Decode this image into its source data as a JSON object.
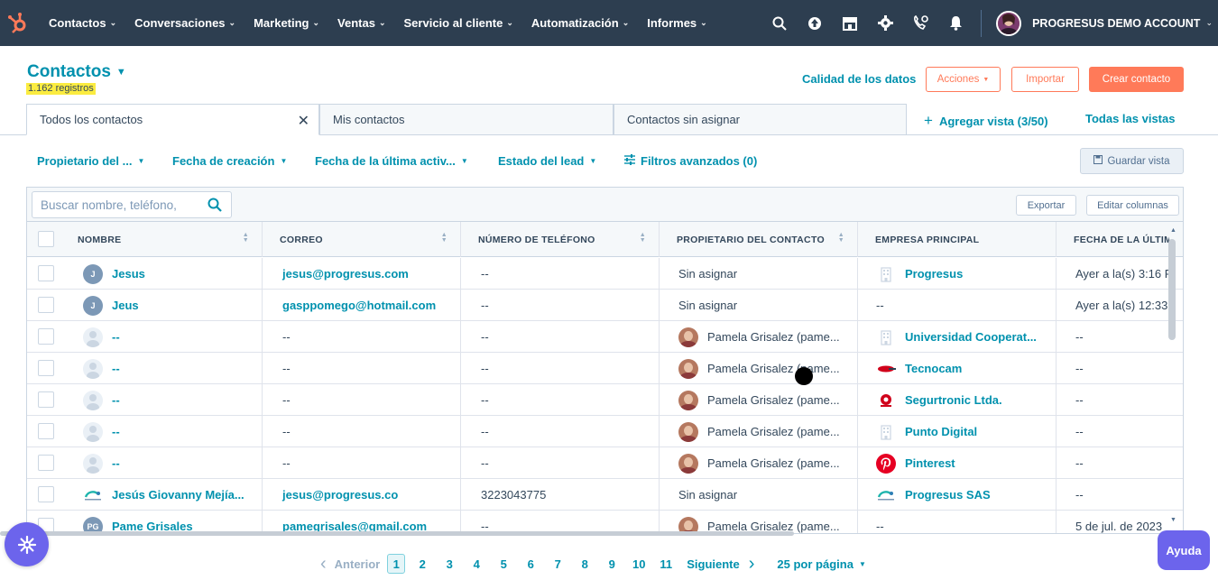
{
  "nav": {
    "items": [
      {
        "label": "Contactos"
      },
      {
        "label": "Conversaciones"
      },
      {
        "label": "Marketing"
      },
      {
        "label": "Ventas"
      },
      {
        "label": "Servicio al cliente"
      },
      {
        "label": "Automatización"
      },
      {
        "label": "Informes"
      }
    ],
    "icons": [
      "search-icon",
      "upgrade-icon",
      "marketplace-icon",
      "settings-icon",
      "calling-icon",
      "notifications-icon"
    ],
    "account_name": "PROGRESUS DEMO ACCOUNT"
  },
  "header": {
    "title": "Contactos",
    "record_count": "1.162 registros",
    "data_quality_link": "Calidad de los datos",
    "actions_label": "Acciones",
    "import_label": "Importar",
    "create_label": "Crear contacto"
  },
  "views": {
    "tabs": [
      {
        "label": "Todos los contactos",
        "active": true
      },
      {
        "label": "Mis contactos"
      },
      {
        "label": "Contactos sin asignar"
      }
    ],
    "add_view": "Agregar vista (3/50)",
    "all_views": "Todas las vistas"
  },
  "filters": {
    "items": [
      {
        "label": "Propietario del ..."
      },
      {
        "label": "Fecha de creación"
      },
      {
        "label": "Fecha de la última activ..."
      },
      {
        "label": "Estado del lead"
      }
    ],
    "advanced": "Filtros avanzados (0)",
    "save_view": "Guardar vista"
  },
  "table": {
    "search_placeholder": "Buscar nombre, teléfono,",
    "export_label": "Exportar",
    "edit_columns_label": "Editar columnas",
    "columns": [
      "NOMBRE",
      "CORREO",
      "NÚMERO DE TELÉFONO",
      "PROPIETARIO DEL CONTACTO",
      "EMPRESA PRINCIPAL",
      "FECHA DE LA ÚLTIM"
    ],
    "rows": [
      {
        "avatar": "J",
        "name": "Jesus",
        "email": "jesus@progresus.com",
        "phone": "--",
        "owner": "Sin asignar",
        "company": "Progresus",
        "company_icon": "building-icon",
        "last_activity": "Ayer a la(s) 3:16 P"
      },
      {
        "avatar": "J",
        "name": "Jeus",
        "email": "gasppomego@hotmail.com",
        "phone": "--",
        "owner": "Sin asignar",
        "company": "--",
        "company_icon": "",
        "last_activity": "Ayer a la(s) 12:33"
      },
      {
        "avatar": "",
        "name": "--",
        "email": "--",
        "phone": "--",
        "owner": "Pamela Grisalez (pame...",
        "company": "Universidad Cooperat...",
        "company_icon": "building-icon",
        "last_activity": "--"
      },
      {
        "avatar": "",
        "name": "--",
        "email": "--",
        "phone": "--",
        "owner": "Pamela Grisalez (pame...",
        "company": "Tecnocam",
        "company_icon": "tecnocam-logo",
        "last_activity": "--"
      },
      {
        "avatar": "",
        "name": "--",
        "email": "--",
        "phone": "--",
        "owner": "Pamela Grisalez (pame...",
        "company": "Segurtronic Ltda.",
        "company_icon": "segurtronic-logo",
        "last_activity": "--"
      },
      {
        "avatar": "",
        "name": "--",
        "email": "--",
        "phone": "--",
        "owner": "Pamela Grisalez (pame...",
        "company": "Punto Digital",
        "company_icon": "building-icon",
        "last_activity": "--"
      },
      {
        "avatar": "",
        "name": "--",
        "email": "--",
        "phone": "--",
        "owner": "Pamela Grisalez (pame...",
        "company": "Pinterest",
        "company_icon": "pinterest-logo",
        "last_activity": "--"
      },
      {
        "avatar": "progresus-logo",
        "name": "Jesús Giovanny Mejía...",
        "email": "jesus@progresus.co",
        "phone": "3223043775",
        "owner": "Sin asignar",
        "company": "Progresus SAS",
        "company_icon": "progresus-logo",
        "last_activity": "--"
      },
      {
        "avatar": "PG",
        "name": "Pame Grisales",
        "email": "pamegrisales@gmail.com",
        "phone": "--",
        "owner": "Pamela Grisalez (pame...",
        "company": "--",
        "company_icon": "",
        "last_activity": "5 de jul. de 2023"
      }
    ]
  },
  "pagination": {
    "prev_label": "Anterior",
    "pages": [
      "1",
      "2",
      "3",
      "4",
      "5",
      "6",
      "7",
      "8",
      "9",
      "10",
      "11"
    ],
    "current_page": "1",
    "next_label": "Siguiente",
    "per_page": "25 por página"
  },
  "help_label": "Ayuda",
  "colors": {
    "nav_bg": "#2d3e50",
    "accent": "#0091ae",
    "primary": "#ff7a59",
    "chat": "#6c64ec"
  }
}
